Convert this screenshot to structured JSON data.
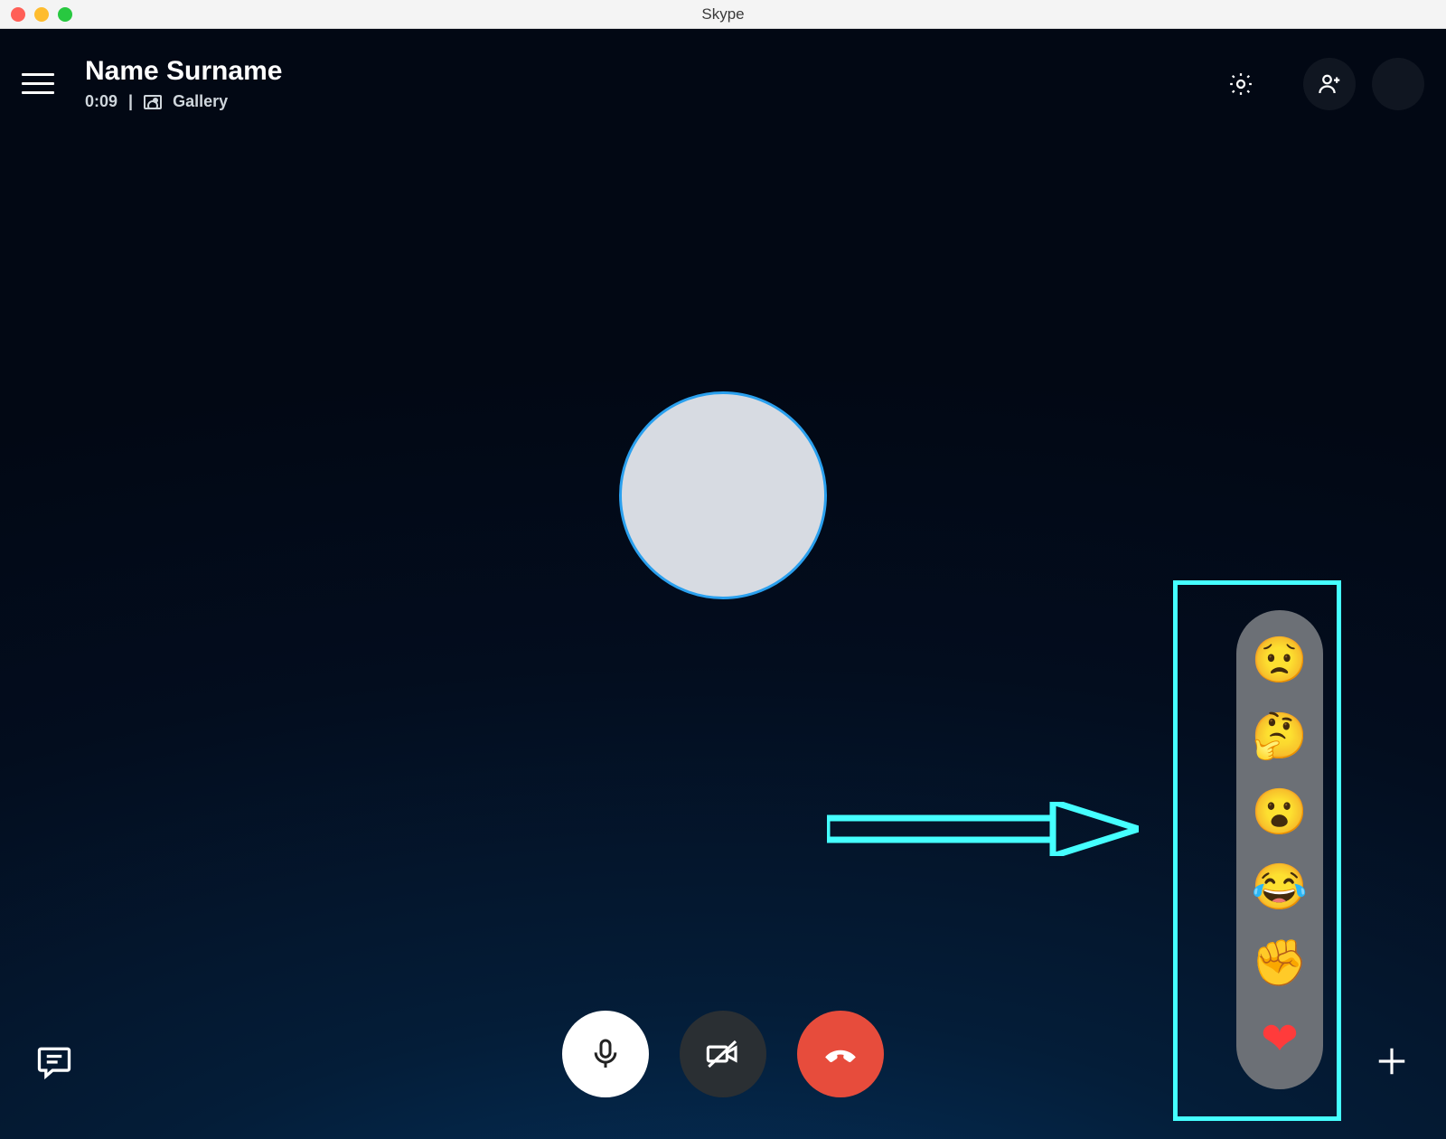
{
  "titlebar": {
    "app_name": "Skype"
  },
  "header": {
    "contact_name": "Name Surname",
    "call_duration": "0:09",
    "separator": "|",
    "view_label": "Gallery"
  },
  "reactions": {
    "items": [
      {
        "name": "sad-reaction",
        "glyph": "😟"
      },
      {
        "name": "thinking-reaction",
        "glyph": "🤔"
      },
      {
        "name": "surprised-reaction",
        "glyph": "😮"
      },
      {
        "name": "laugh-reaction",
        "glyph": "😂"
      },
      {
        "name": "fist-reaction",
        "glyph": "✊"
      },
      {
        "name": "heart-reaction",
        "glyph": "❤"
      }
    ]
  },
  "controls": {
    "mic": "mic-button",
    "camera": "camera-off-button",
    "hangup": "end-call-button",
    "chat": "chat-button",
    "more": "more-actions-button"
  }
}
